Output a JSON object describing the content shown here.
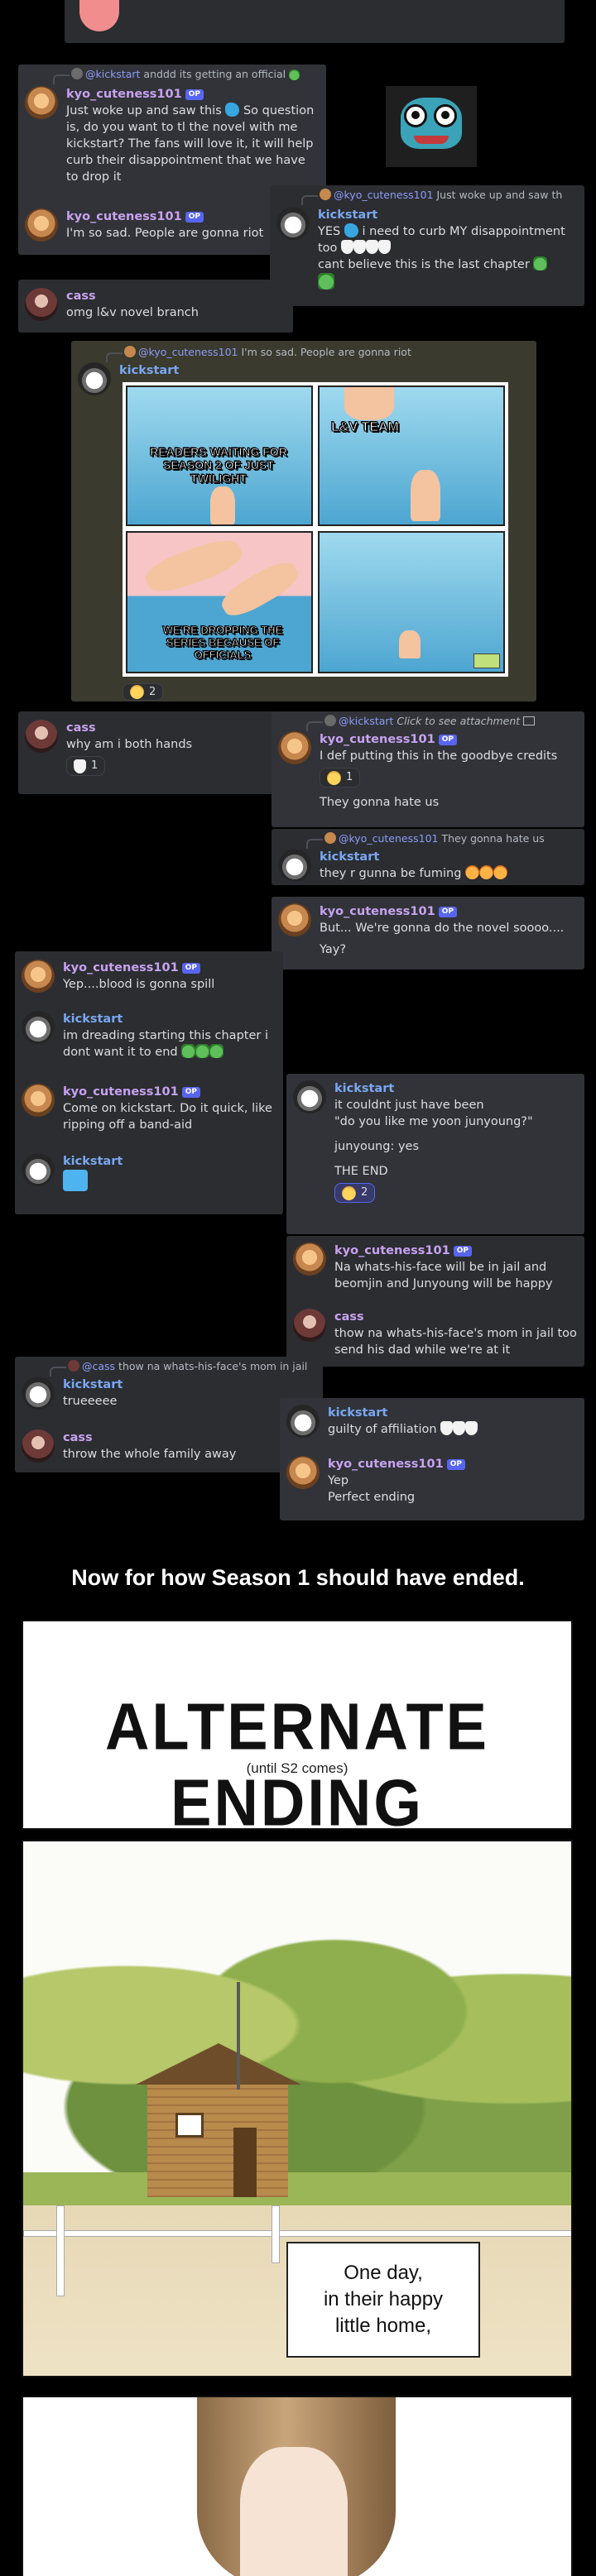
{
  "messages": {
    "m1_reply": "anddd its getting an official",
    "m1_reply_name": "@kickstart",
    "kyo": "kyo_cuteness101",
    "kick": "kickstart",
    "cass": "cass",
    "op_tag": "OP",
    "m1_text": "Just woke up and saw this",
    "m1_text2": "So question is, do you want to tl the novel with me kickstart? The fans will love it, it will help curb their disappointment that we have to drop it",
    "m2_text": "I'm so sad. People are gonna riot",
    "m3_reply_name": "@kyo_cuteness101",
    "m3_reply": "Just woke up and saw th",
    "m3_text": "YES",
    "m3_text2": "i need to curb MY disappointment too",
    "m3_text3": "cant believe this is the last chapter",
    "m4_text": "omg l&v novel branch",
    "m5_reply_name": "@kyo_cuteness101",
    "m5_reply": "I'm so sad. People are gonna riot",
    "meme_caption1": "READERS WAITING FOR SEASON 2 OF JUST TWILIGHT",
    "meme_caption2": "L&V TEAM",
    "meme_caption3": "WE'RE DROPPING THE SERIES BECAUSE OF OFFICIALS",
    "meme_react": "2",
    "m6_text": "why am i both hands",
    "m6_react": "1",
    "m7_reply_name": "@kickstart",
    "m7_reply": "Click to see attachment",
    "m7_text": "I def putting this in the goodbye credits",
    "m7_react": "1",
    "m7_text2": "They gonna hate us",
    "m8_reply_name": "@kyo_cuteness101",
    "m8_reply": "They gonna hate us",
    "m8_text": "they r gunna be fuming",
    "m9_text": "But... We're gonna do the novel soooo....",
    "m9_text2": "Yay?",
    "m10_text": "Yep....blood is gonna spill",
    "m11_text": "im dreading starting this chapter i dont want it to end",
    "m12_text": "Come on kickstart. Do it quick, like ripping off a band-aid",
    "m14_text": "it couldnt just have been",
    "m14_text2": "\"do you like me yoon junyoung?\"",
    "m14_text3": "junyoung: yes",
    "m14_text4": "THE END",
    "m14_react": "2",
    "m15_text": "Na whats-his-face will be in jail and beomjin and Junyoung will be happy",
    "m16_text": "thow na whats-his-face's mom in jail too send his dad while we're at it",
    "m17_reply_name": "@cass",
    "m17_reply": "thow na whats-his-face's mom in jail",
    "m17_text": "trueeeee",
    "m18_text": "throw the whole family away",
    "m19_text": "guilty of affiliation",
    "m20_text": "Yep",
    "m20_text2": "Perfect ending"
  },
  "caption": "Now for how Season 1 should have ended.",
  "comic": {
    "title": "ALTERNATE ENDING",
    "subtitle": "(until S2 comes)",
    "narration1": "One day,",
    "narration2": "in their happy",
    "narration3": "little home,"
  },
  "colors": {
    "background": "#000000",
    "card": "#313338",
    "name_purple": "#c8a2f0",
    "name_blue": "#7aa7f0",
    "accent": "#5865f2"
  }
}
